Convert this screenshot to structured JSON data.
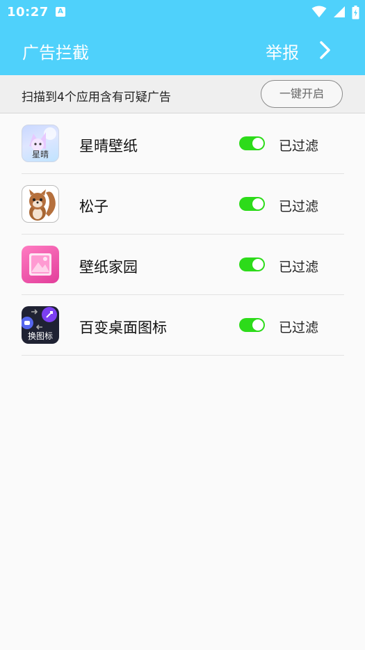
{
  "status_bar": {
    "time": "10:27",
    "notification_icon": "A"
  },
  "app_bar": {
    "title": "广告拦截",
    "report_label": "举报"
  },
  "scan_bar": {
    "message": "扫描到4个应用含有可疑广告",
    "enable_all_label": "一键开启"
  },
  "apps": [
    {
      "name": "星晴壁纸",
      "icon": "xingqing-wallpaper-icon",
      "icon_text": "星晴",
      "filter_on": true,
      "status": "已过滤"
    },
    {
      "name": "松子",
      "icon": "squirrel-icon",
      "filter_on": true,
      "status": "已过滤"
    },
    {
      "name": "壁纸家园",
      "icon": "pink-picture-icon",
      "filter_on": true,
      "status": "已过滤"
    },
    {
      "name": "百变桌面图标",
      "icon": "change-icon-app-icon",
      "icon_text": "换图标",
      "filter_on": true,
      "status": "已过滤"
    }
  ],
  "colors": {
    "accent": "#4fd1fb",
    "toggle_on": "#2ddb1a"
  }
}
